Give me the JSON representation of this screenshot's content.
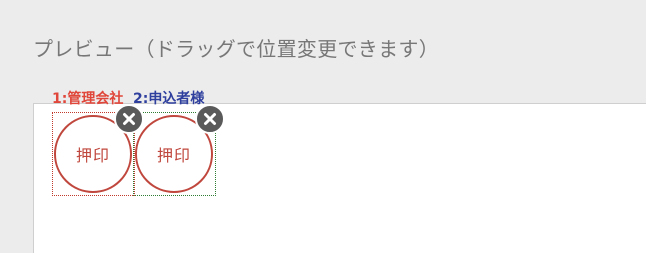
{
  "header": {
    "title": "プレビュー（ドラッグで位置変更できます）"
  },
  "stamps": [
    {
      "label": "1:管理会社",
      "stamp_text": "押印",
      "frame_color": "#c0392b",
      "label_color": "#e0463a",
      "delete_icon": "close-icon"
    },
    {
      "label": "2:申込者様",
      "stamp_text": "押印",
      "frame_color": "#2e7d32",
      "label_color": "#2e3f9e",
      "delete_icon": "close-icon"
    }
  ],
  "colors": {
    "background": "#ececec",
    "canvas": "#ffffff",
    "stamp_red": "#c0473d",
    "delete_button": "#5a5a5a"
  }
}
